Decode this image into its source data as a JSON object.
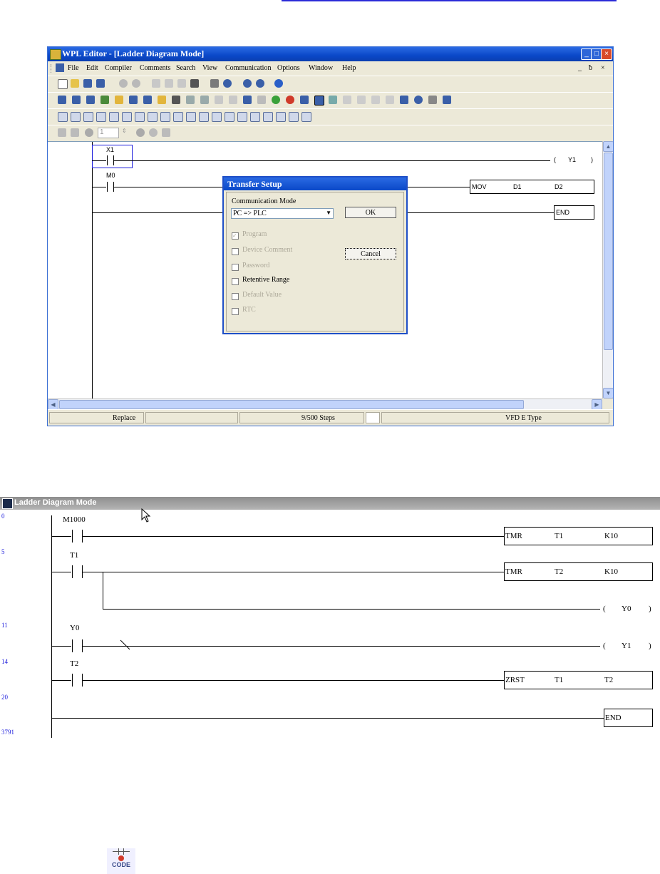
{
  "window": {
    "title": "WPL Editor - [Ladder Diagram Mode]",
    "menu": [
      "File",
      "Edit",
      "Compiler",
      "Comments",
      "Search",
      "View",
      "Communication",
      "Options",
      "Window",
      "Help"
    ],
    "step_value": "1"
  },
  "ladder1": {
    "contacts": [
      "X1",
      "M0"
    ],
    "coil": "Y1",
    "coil_paren_open": "(",
    "coil_paren_close": ")",
    "mov": {
      "op": "MOV",
      "a": "D1",
      "b": "D2"
    },
    "end": "END"
  },
  "dialog": {
    "title": "Transfer Setup",
    "mode_label": "Communication Mode",
    "mode_value": "PC => PLC",
    "ok": "OK",
    "cancel": "Cancel",
    "options": [
      {
        "label": "Program",
        "checked": true,
        "disabled": true
      },
      {
        "label": "Device Comment",
        "checked": false,
        "disabled": true
      },
      {
        "label": "Password",
        "checked": false,
        "disabled": true
      },
      {
        "label": "Retentive Range",
        "checked": false,
        "disabled": false
      },
      {
        "label": "Default Value",
        "checked": false,
        "disabled": true
      },
      {
        "label": "RTC",
        "checked": false,
        "disabled": true
      }
    ]
  },
  "status": {
    "mode": "Replace",
    "steps": "9/500 Steps",
    "device": "VFD E Type"
  },
  "panel2": {
    "title": "Ladder Diagram Mode",
    "steps": [
      "0",
      "5",
      "11",
      "14",
      "20",
      "3791"
    ],
    "contacts": [
      "M1000",
      "T1",
      "Y0",
      "T2"
    ],
    "tmr1": {
      "op": "TMR",
      "a": "T1",
      "b": "K10"
    },
    "tmr2": {
      "op": "TMR",
      "a": "T2",
      "b": "K10"
    },
    "coil_y0": "Y0",
    "coil_y1": "Y1",
    "zrst": {
      "op": "ZRST",
      "a": "T1",
      "b": "T2"
    },
    "end": "END",
    "paren_open": "(",
    "paren_close": ")"
  },
  "bottom_icon_text": "CODE"
}
